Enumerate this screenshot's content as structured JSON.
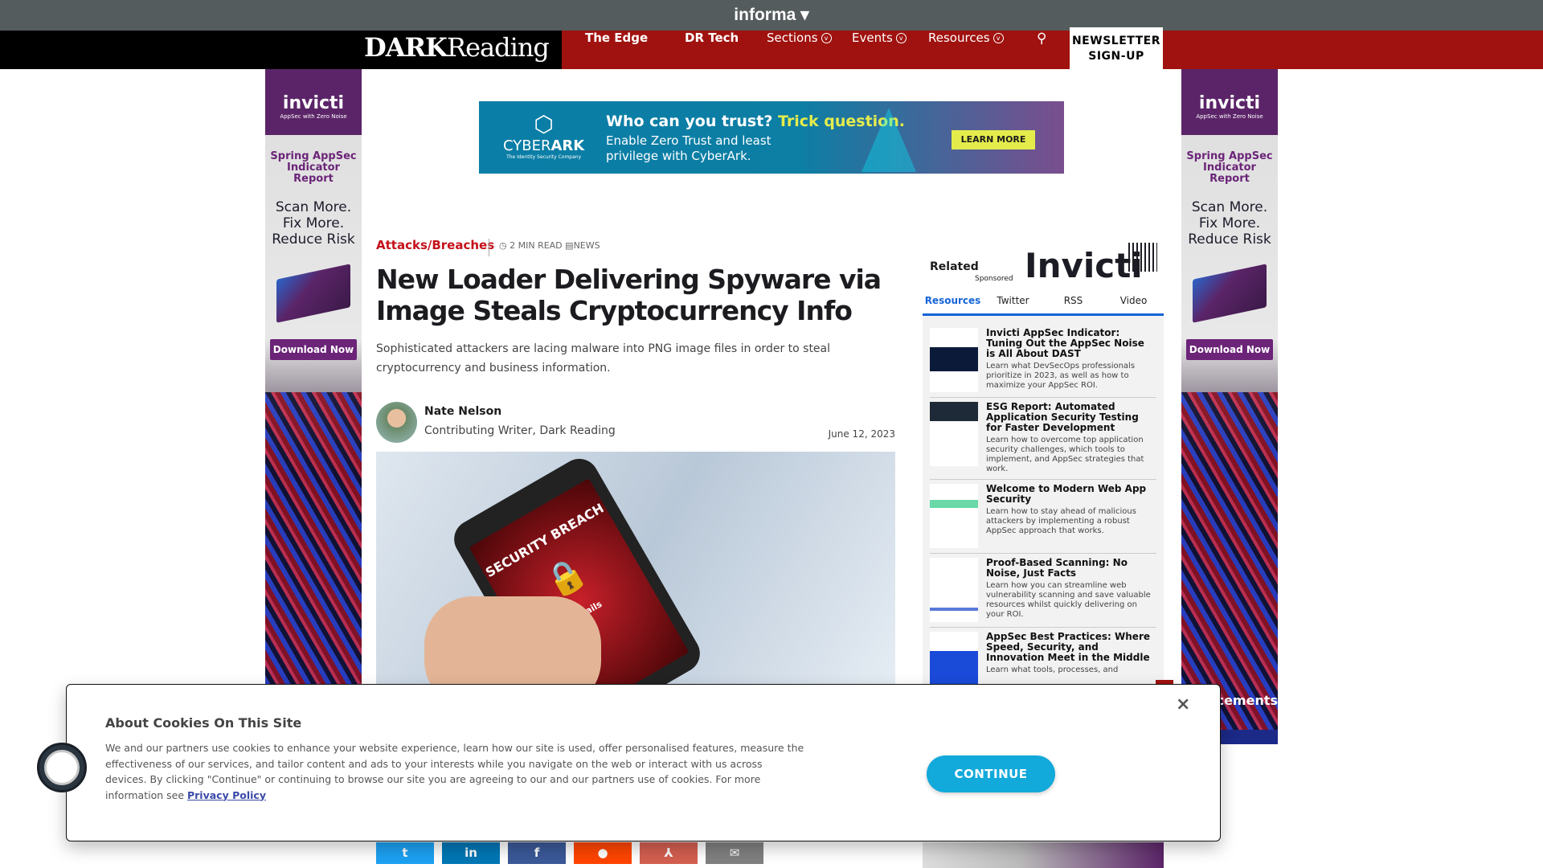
{
  "topbar": {
    "brand": "informa ▾"
  },
  "nav": {
    "logo_bold": "DARK",
    "logo_light": "Reading",
    "items": [
      {
        "label": "The Edge"
      },
      {
        "label": "DR Tech"
      },
      {
        "label": "Sections"
      },
      {
        "label": "Events"
      },
      {
        "label": "Resources"
      }
    ],
    "newsletter": "NEWSLETTER SIGN-UP",
    "accent": "#a0120f"
  },
  "side_ad": {
    "brand": "invicti",
    "tagline": "AppSec with Zero Noise",
    "report": "Spring AppSec Indicator Report",
    "headline": "Scan More. Fix More. Reduce Risk",
    "cta": "Download Now"
  },
  "banner_ad": {
    "brand": "CYBER",
    "brand_bold": "ARK",
    "brand_sub": "The Identity Security Company",
    "headline": "Who can you trust?",
    "highlight": "Trick question.",
    "sub": "Enable Zero Trust and least privilege with CyberArk.",
    "cta": "LEARN MORE"
  },
  "article": {
    "category": "Attacks/Breaches",
    "read_time": "2 MIN READ",
    "type": "NEWS",
    "title": "New Loader Delivering Spyware via Image Steals Cryptocurrency Info",
    "summary": "Sophisticated attackers are lacing malware into PNG image files in order to steal cryptocurrency and business information.",
    "author": "Nate Nelson",
    "author_role": "Contributing Writer, Dark Reading",
    "date": "June 12, 2023",
    "hero_text": "SECURITY BREACH",
    "hero_button": "Details"
  },
  "related": {
    "label": "Related",
    "sponsored": "Sponsored",
    "sponsor": "Invicti",
    "tabs": [
      {
        "label": "Resources",
        "active": true
      },
      {
        "label": "Twitter"
      },
      {
        "label": "RSS"
      },
      {
        "label": "Video"
      }
    ],
    "items": [
      {
        "title": "Invicti AppSec Indicator: Tuning Out the AppSec Noise is All About DAST",
        "desc": "Learn what DevSecOps professionals prioritize in 2023, as well as how to maximize your AppSec ROI."
      },
      {
        "title": "ESG Report: Automated Application Security Testing for Faster Development",
        "desc": "Learn how to overcome top application security challenges, which tools to implement, and AppSec strategies that work."
      },
      {
        "title": "Welcome to Modern Web App Security",
        "desc": "Learn how to stay ahead of malicious attackers by implementing a robust AppSec approach that works."
      },
      {
        "title": "Proof-Based Scanning: No Noise, Just Facts",
        "desc": "Learn how you can streamline web vulnerability scanning and save valuable resources whilst quickly delivering on your ROI."
      },
      {
        "title": "AppSec Best Practices: Where Speed, Security, and Innovation Meet in the Middle",
        "desc": "Learn what tools, processes, and"
      }
    ]
  },
  "partial_label": "cements",
  "cookie": {
    "title": "About Cookies On This Site",
    "text": "We and our partners use cookies to enhance your website experience, learn how our site is used, offer personalised features, measure the effectiveness of our services, and tailor content and ads to your interests while you navigate on the web or interact with us across devices. By clicking \"Continue\" or continuing to browse our site you are agreeing to our and our partners use of cookies. For more information see ",
    "link": "Privacy Policy",
    "close": "×",
    "continue": "CONTINUE"
  },
  "share": [
    {
      "icon": "twitter-icon",
      "glyph": "t",
      "color": "#1da1f2"
    },
    {
      "icon": "linkedin-icon",
      "glyph": "in",
      "color": "#0077b5"
    },
    {
      "icon": "facebook-icon",
      "glyph": "f",
      "color": "#3b5998"
    },
    {
      "icon": "reddit-icon",
      "glyph": "●",
      "color": "#ff4500"
    },
    {
      "icon": "pdf-icon",
      "glyph": "⅄",
      "color": "#d35f50"
    },
    {
      "icon": "email-icon",
      "glyph": "✉",
      "color": "#808080"
    }
  ]
}
